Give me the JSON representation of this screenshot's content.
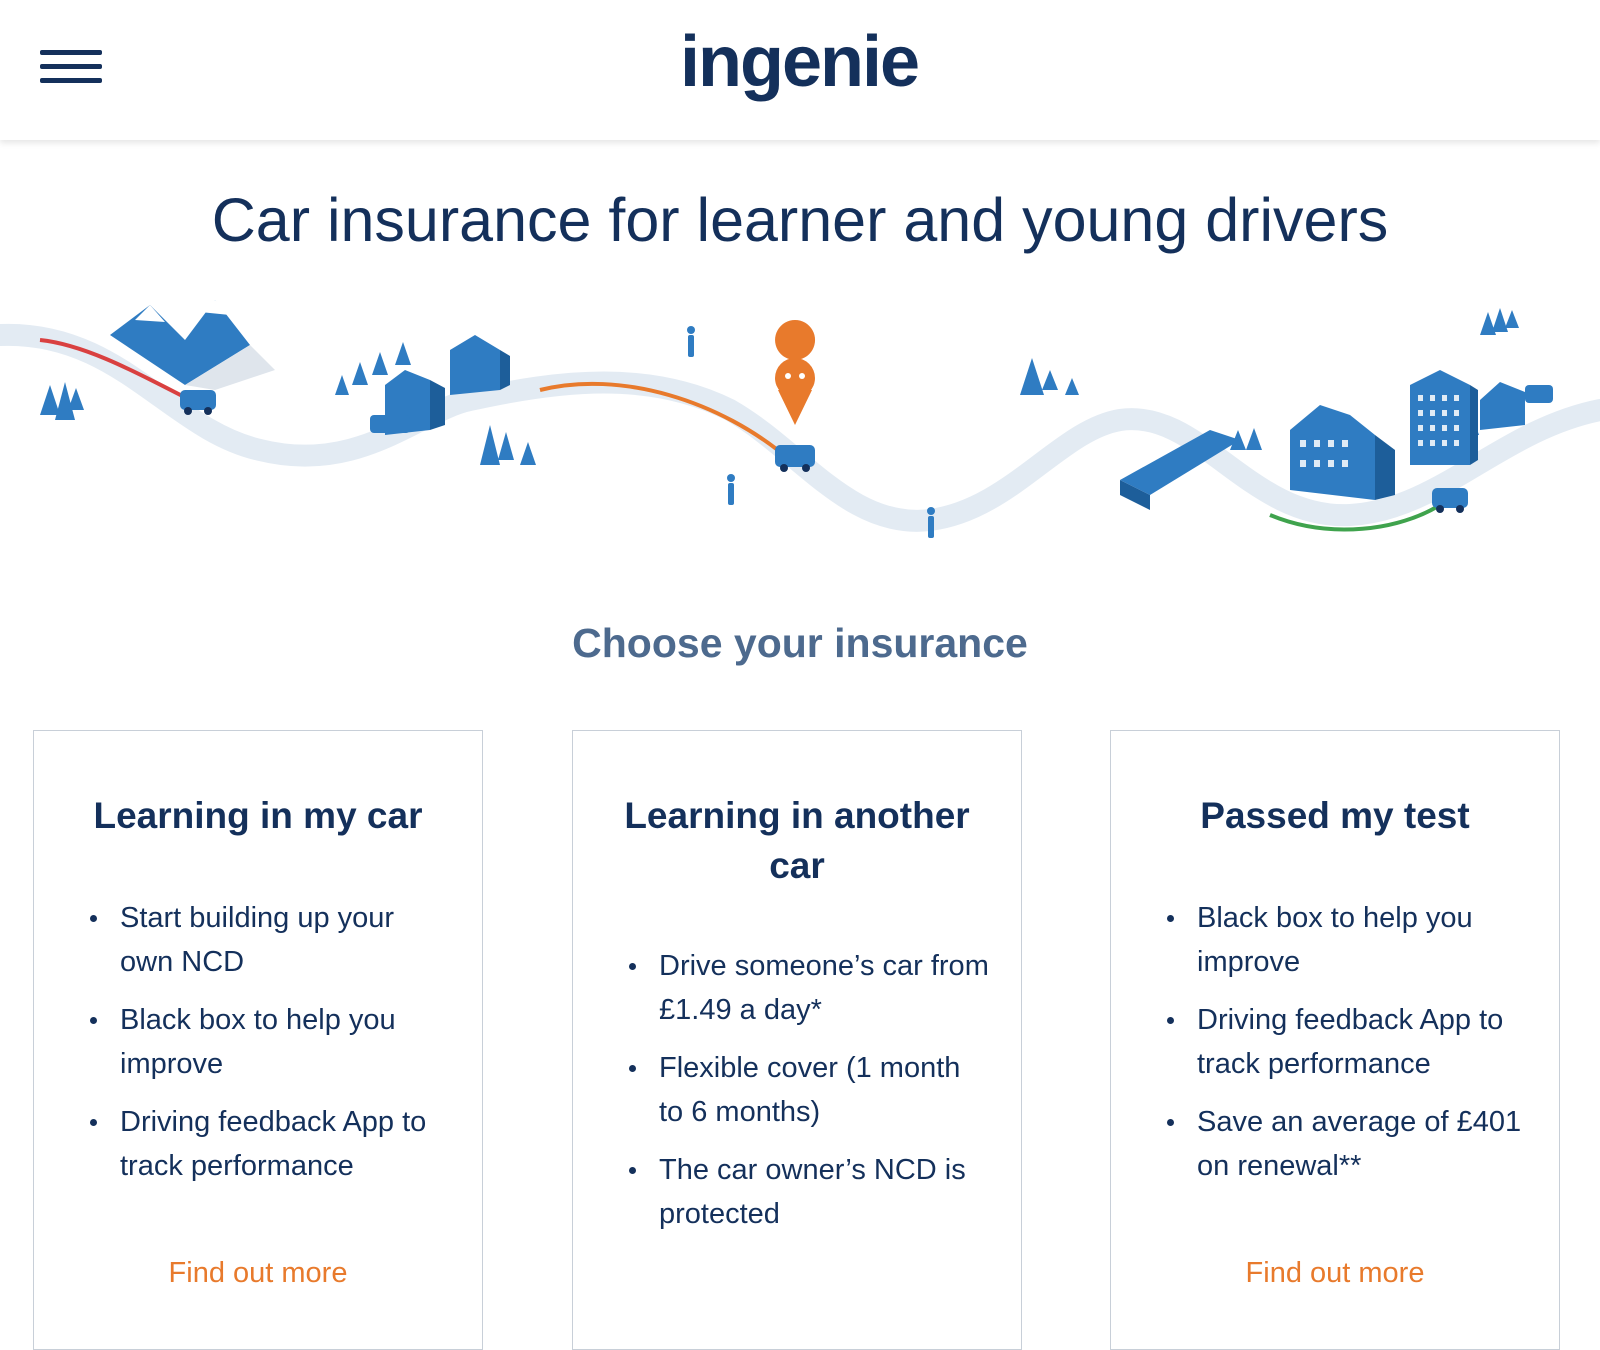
{
  "header": {
    "brand": "ingenie",
    "menu_icon": "hamburger-menu-icon"
  },
  "hero": {
    "title": "Car insurance for learner and young drivers"
  },
  "section": {
    "title": "Choose your insurance"
  },
  "cards": [
    {
      "title": "Learning in my car",
      "bullets": [
        "Start building up your own NCD",
        "Black box to help you improve",
        "Driving feedback App to track performance"
      ],
      "link": "Find out more"
    },
    {
      "title": "Learning in another car",
      "bullets": [
        "Drive someone’s car from £1.49 a day*",
        "Flexible cover (1 month to 6 months)",
        "The car owner’s NCD is protected"
      ],
      "link": ""
    },
    {
      "title": "Passed my test",
      "bullets": [
        "Black box to help you improve",
        "Driving feedback App to track performance",
        "Save an average of £401 on renewal**"
      ],
      "link": "Find out more"
    }
  ],
  "colors": {
    "navy": "#14305b",
    "accent_orange": "#e87a2c",
    "illustration_blue": "#2f7cc2"
  }
}
